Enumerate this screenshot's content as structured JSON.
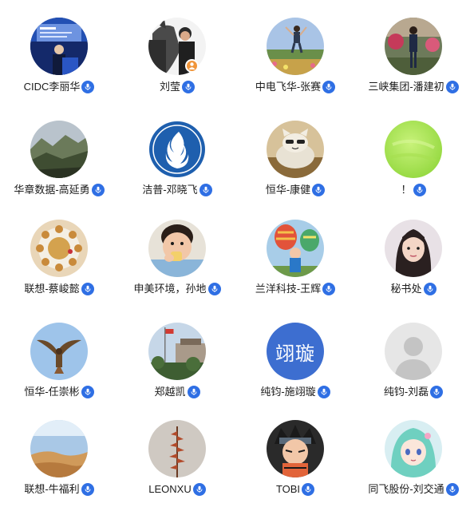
{
  "members": [
    {
      "name": "CIDC李丽华",
      "avatar_icon": "conference-stage-photo",
      "mic_icon": "microphone-icon"
    },
    {
      "name": "刘莹",
      "avatar_icon": "person-with-horse-photo",
      "mic_icon": "microphone-icon",
      "role_icon": "host-person-icon"
    },
    {
      "name": "中电飞华-张赛",
      "avatar_icon": "person-jumping-landscape-photo",
      "mic_icon": "microphone-icon"
    },
    {
      "name": "三峡集团-潘建初",
      "avatar_icon": "person-standing-garden-photo",
      "mic_icon": "microphone-icon"
    },
    {
      "name": "华章数据-高延勇",
      "avatar_icon": "mountain-valley-photo",
      "mic_icon": "microphone-icon"
    },
    {
      "name": "洁普-邓晓飞",
      "avatar_icon": "flame-logo",
      "mic_icon": "microphone-icon"
    },
    {
      "name": "恒华-康健",
      "avatar_icon": "cat-cartoon-photo",
      "mic_icon": "microphone-icon"
    },
    {
      "name": "！",
      "avatar_icon": "lime-green-gradient",
      "mic_icon": "microphone-icon"
    },
    {
      "name": "联想-蔡峻懿",
      "avatar_icon": "cake-ring-photo",
      "mic_icon": "microphone-icon"
    },
    {
      "name": "申美环境，孙地",
      "avatar_icon": "child-eating-photo",
      "mic_icon": "microphone-icon"
    },
    {
      "name": "兰洋科技-王辉",
      "avatar_icon": "child-hot-air-balloon-photo",
      "mic_icon": "microphone-icon"
    },
    {
      "name": "秘书处",
      "avatar_icon": "woman-portrait-photo",
      "mic_icon": "microphone-icon"
    },
    {
      "name": "恒华-任崇彬",
      "avatar_icon": "eagle-flying-photo",
      "mic_icon": "microphone-icon"
    },
    {
      "name": "郑越凯",
      "avatar_icon": "square-flagpole-photo",
      "mic_icon": "microphone-icon"
    },
    {
      "name": "纯钧-施翊璇",
      "avatar_icon": "text-avatar",
      "avatar_text": "翊璇",
      "mic_icon": "microphone-icon"
    },
    {
      "name": "纯钧-刘磊",
      "avatar_icon": "default-person-silhouette",
      "mic_icon": "microphone-icon"
    },
    {
      "name": "联想-牛福利",
      "avatar_icon": "desert-landscape-photo",
      "mic_icon": "microphone-icon"
    },
    {
      "name": "LEONXU",
      "avatar_icon": "plant-stalk-photo",
      "mic_icon": "microphone-icon"
    },
    {
      "name": "TOBI",
      "avatar_icon": "anime-ninja-photo",
      "mic_icon": "microphone-icon"
    },
    {
      "name": "同飞股份-刘交通",
      "avatar_icon": "anime-girl-photo",
      "mic_icon": "microphone-icon"
    }
  ],
  "colors": {
    "mic_badge": "#2f6fe4",
    "host_badge": "#f0953a",
    "text_avatar_bg": "#3d6ed0"
  }
}
